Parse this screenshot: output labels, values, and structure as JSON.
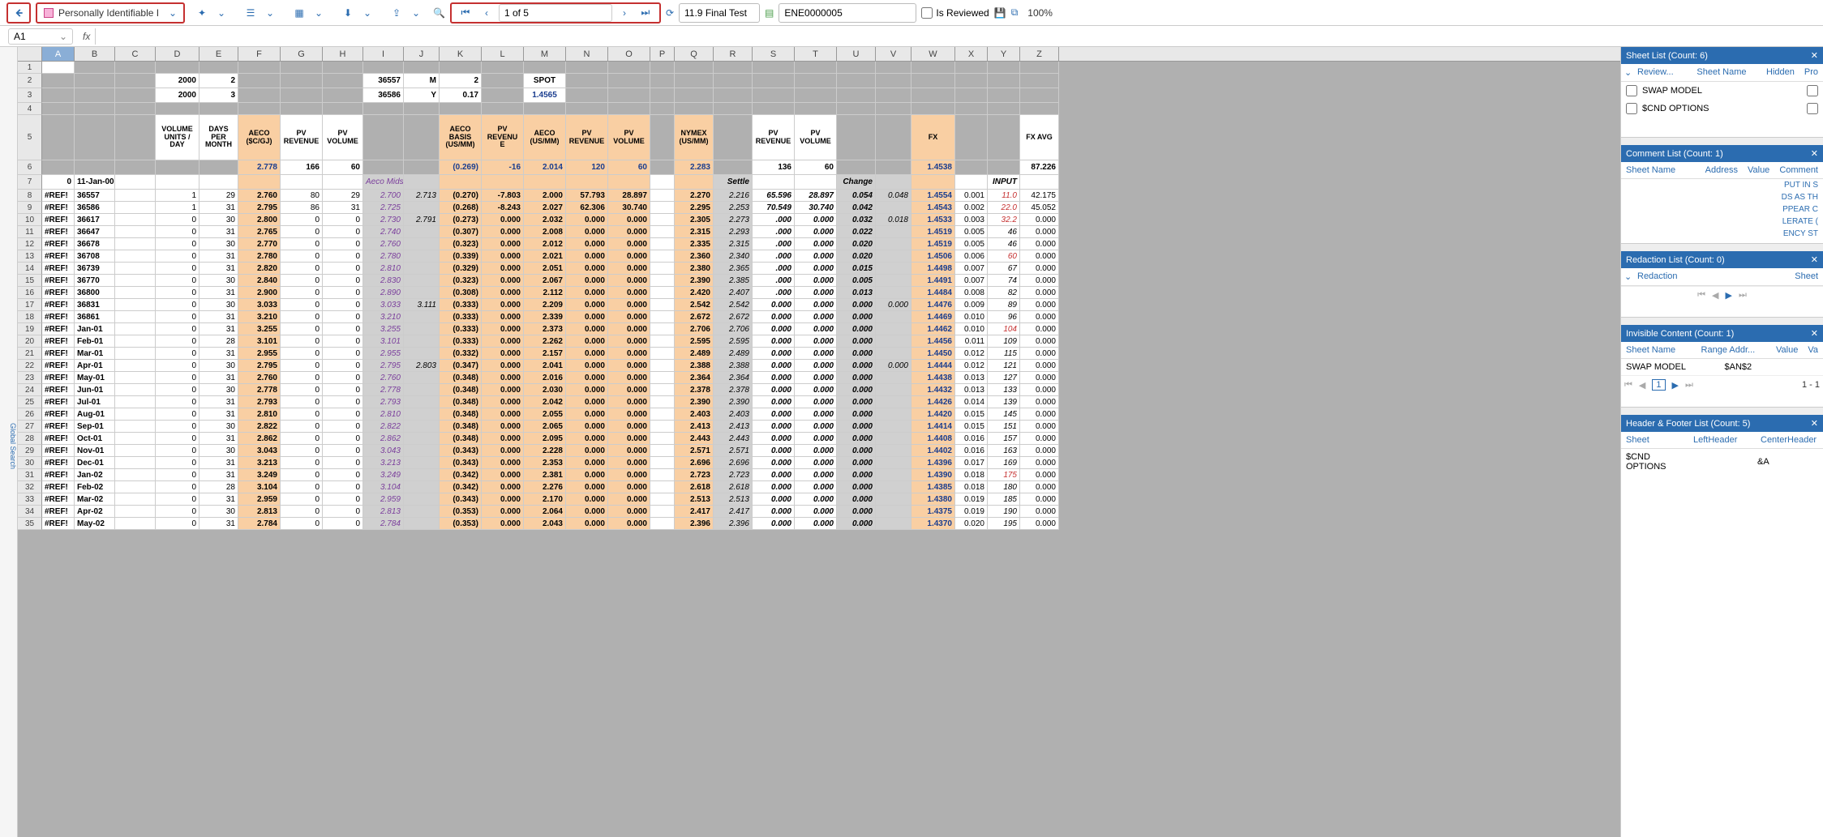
{
  "toolbar": {
    "dropdown_label": "Personally Identifiable I",
    "page_text": "1 of 5",
    "test_name": "11.9 Final Test",
    "doc_id": "ENE0000005",
    "is_reviewed_label": "Is Reviewed",
    "zoom": "100%"
  },
  "formulabar": {
    "cell": "A1",
    "fx": "fx"
  },
  "left_strip": "Global Search",
  "columns": [
    "A",
    "B",
    "C",
    "D",
    "E",
    "F",
    "G",
    "H",
    "I",
    "J",
    "K",
    "L",
    "M",
    "N",
    "O",
    "P",
    "Q",
    "R",
    "S",
    "T",
    "U",
    "V",
    "W",
    "X",
    "Y",
    "Z"
  ],
  "row2": {
    "D": "2000",
    "E": "2",
    "I": "36557",
    "J": "M",
    "K": "2",
    "M": "SPOT"
  },
  "row3": {
    "D": "2000",
    "E": "3",
    "I": "36586",
    "J": "Y",
    "K": "0.17",
    "M": "1.4565"
  },
  "headers5": {
    "D": "VOLUME UNITS / DAY",
    "E": "DAYS PER MONTH",
    "F": "AECO ($C/GJ)",
    "G": "PV REVENUE",
    "H": "PV VOLUME",
    "K": "AECO BASIS (US/MM)",
    "L": "PV REVENU E",
    "M": "AECO (US/MM)",
    "N": "PV REVENUE",
    "O": "PV VOLUME",
    "Q": "NYMEX (US/MM)",
    "S": "PV REVENUE",
    "T": "PV VOLUME",
    "W": "FX",
    "Z": "FX AVG"
  },
  "row6": {
    "F": "2.778",
    "G": "166",
    "H": "60",
    "K": "(0.269)",
    "L": "-16",
    "M": "2.014",
    "N": "120",
    "O": "60",
    "Q": "2.283",
    "S": "136",
    "T": "60",
    "W": "1.4538",
    "Z": "87.226"
  },
  "row7": {
    "A": "0",
    "B": "11-Jan-00",
    "I": "Aeco Mids",
    "R": "Settle",
    "U": "Change",
    "Y": "INPUT"
  },
  "data_rows": [
    {
      "rn": 8,
      "A": "#REF!",
      "B": "36557",
      "D": "1",
      "E": "29",
      "F": "2.760",
      "G": "80",
      "H": "29",
      "I": "2.700",
      "J": "2.713",
      "K": "(0.270)",
      "L": "-7.803",
      "M": "2.000",
      "N": "57.793",
      "O": "28.897",
      "Q": "2.270",
      "R": "2.216",
      "S": "65.596",
      "T": "28.897",
      "U": "0.054",
      "V": "0.048",
      "W": "1.4554",
      "X": "0.001",
      "Y": "11.0",
      "Z": "42.175"
    },
    {
      "rn": 9,
      "A": "#REF!",
      "B": "36586",
      "D": "1",
      "E": "31",
      "F": "2.795",
      "G": "86",
      "H": "31",
      "I": "2.725",
      "J": "",
      "K": "(0.268)",
      "L": "-8.243",
      "M": "2.027",
      "N": "62.306",
      "O": "30.740",
      "Q": "2.295",
      "R": "2.253",
      "S": "70.549",
      "T": "30.740",
      "U": "0.042",
      "V": "",
      "W": "1.4543",
      "X": "0.002",
      "Y": "22.0",
      "Z": "45.052"
    },
    {
      "rn": 10,
      "A": "#REF!",
      "B": "36617",
      "D": "0",
      "E": "30",
      "F": "2.800",
      "G": "0",
      "H": "0",
      "I": "2.730",
      "J": "2.791",
      "K": "(0.273)",
      "L": "0.000",
      "M": "2.032",
      "N": "0.000",
      "O": "0.000",
      "Q": "2.305",
      "R": "2.273",
      "S": ".000",
      "T": "0.000",
      "U": "0.032",
      "V": "0.018",
      "W": "1.4533",
      "X": "0.003",
      "Y": "32.2",
      "Z": "0.000"
    },
    {
      "rn": 11,
      "A": "#REF!",
      "B": "36647",
      "D": "0",
      "E": "31",
      "F": "2.765",
      "G": "0",
      "H": "0",
      "I": "2.740",
      "J": "",
      "K": "(0.307)",
      "L": "0.000",
      "M": "2.008",
      "N": "0.000",
      "O": "0.000",
      "Q": "2.315",
      "R": "2.293",
      "S": ".000",
      "T": "0.000",
      "U": "0.022",
      "V": "",
      "W": "1.4519",
      "X": "0.005",
      "Y": "46",
      "Z": "0.000"
    },
    {
      "rn": 12,
      "A": "#REF!",
      "B": "36678",
      "D": "0",
      "E": "30",
      "F": "2.770",
      "G": "0",
      "H": "0",
      "I": "2.760",
      "J": "",
      "K": "(0.323)",
      "L": "0.000",
      "M": "2.012",
      "N": "0.000",
      "O": "0.000",
      "Q": "2.335",
      "R": "2.315",
      "S": ".000",
      "T": "0.000",
      "U": "0.020",
      "V": "",
      "W": "1.4519",
      "X": "0.005",
      "Y": "46",
      "Z": "0.000"
    },
    {
      "rn": 13,
      "A": "#REF!",
      "B": "36708",
      "D": "0",
      "E": "31",
      "F": "2.780",
      "G": "0",
      "H": "0",
      "I": "2.780",
      "J": "",
      "K": "(0.339)",
      "L": "0.000",
      "M": "2.021",
      "N": "0.000",
      "O": "0.000",
      "Q": "2.360",
      "R": "2.340",
      "S": ".000",
      "T": "0.000",
      "U": "0.020",
      "V": "",
      "W": "1.4506",
      "X": "0.006",
      "Y": "60",
      "Z": "0.000"
    },
    {
      "rn": 14,
      "A": "#REF!",
      "B": "36739",
      "D": "0",
      "E": "31",
      "F": "2.820",
      "G": "0",
      "H": "0",
      "I": "2.810",
      "J": "",
      "K": "(0.329)",
      "L": "0.000",
      "M": "2.051",
      "N": "0.000",
      "O": "0.000",
      "Q": "2.380",
      "R": "2.365",
      "S": ".000",
      "T": "0.000",
      "U": "0.015",
      "V": "",
      "W": "1.4498",
      "X": "0.007",
      "Y": "67",
      "Z": "0.000"
    },
    {
      "rn": 15,
      "A": "#REF!",
      "B": "36770",
      "D": "0",
      "E": "30",
      "F": "2.840",
      "G": "0",
      "H": "0",
      "I": "2.830",
      "J": "",
      "K": "(0.323)",
      "L": "0.000",
      "M": "2.067",
      "N": "0.000",
      "O": "0.000",
      "Q": "2.390",
      "R": "2.385",
      "S": ".000",
      "T": "0.000",
      "U": "0.005",
      "V": "",
      "W": "1.4491",
      "X": "0.007",
      "Y": "74",
      "Z": "0.000"
    },
    {
      "rn": 16,
      "A": "#REF!",
      "B": "36800",
      "D": "0",
      "E": "31",
      "F": "2.900",
      "G": "0",
      "H": "0",
      "I": "2.890",
      "J": "",
      "K": "(0.308)",
      "L": "0.000",
      "M": "2.112",
      "N": "0.000",
      "O": "0.000",
      "Q": "2.420",
      "R": "2.407",
      "S": ".000",
      "T": "0.000",
      "U": "0.013",
      "V": "",
      "W": "1.4484",
      "X": "0.008",
      "Y": "82",
      "Z": "0.000"
    },
    {
      "rn": 17,
      "A": "#REF!",
      "B": "36831",
      "D": "0",
      "E": "30",
      "F": "3.033",
      "G": "0",
      "H": "0",
      "I": "3.033",
      "J": "3.111",
      "K": "(0.333)",
      "L": "0.000",
      "M": "2.209",
      "N": "0.000",
      "O": "0.000",
      "Q": "2.542",
      "R": "2.542",
      "S": "0.000",
      "T": "0.000",
      "U": "0.000",
      "V": "0.000",
      "W": "1.4476",
      "X": "0.009",
      "Y": "89",
      "Z": "0.000"
    },
    {
      "rn": 18,
      "A": "#REF!",
      "B": "36861",
      "D": "0",
      "E": "31",
      "F": "3.210",
      "G": "0",
      "H": "0",
      "I": "3.210",
      "J": "",
      "K": "(0.333)",
      "L": "0.000",
      "M": "2.339",
      "N": "0.000",
      "O": "0.000",
      "Q": "2.672",
      "R": "2.672",
      "S": "0.000",
      "T": "0.000",
      "U": "0.000",
      "V": "",
      "W": "1.4469",
      "X": "0.010",
      "Y": "96",
      "Z": "0.000"
    },
    {
      "rn": 19,
      "A": "#REF!",
      "B": "Jan-01",
      "D": "0",
      "E": "31",
      "F": "3.255",
      "G": "0",
      "H": "0",
      "I": "3.255",
      "J": "",
      "K": "(0.333)",
      "L": "0.000",
      "M": "2.373",
      "N": "0.000",
      "O": "0.000",
      "Q": "2.706",
      "R": "2.706",
      "S": "0.000",
      "T": "0.000",
      "U": "0.000",
      "V": "",
      "W": "1.4462",
      "X": "0.010",
      "Y": "104",
      "Z": "0.000"
    },
    {
      "rn": 20,
      "A": "#REF!",
      "B": "Feb-01",
      "D": "0",
      "E": "28",
      "F": "3.101",
      "G": "0",
      "H": "0",
      "I": "3.101",
      "J": "",
      "K": "(0.333)",
      "L": "0.000",
      "M": "2.262",
      "N": "0.000",
      "O": "0.000",
      "Q": "2.595",
      "R": "2.595",
      "S": "0.000",
      "T": "0.000",
      "U": "0.000",
      "V": "",
      "W": "1.4456",
      "X": "0.011",
      "Y": "109",
      "Z": "0.000"
    },
    {
      "rn": 21,
      "A": "#REF!",
      "B": "Mar-01",
      "D": "0",
      "E": "31",
      "F": "2.955",
      "G": "0",
      "H": "0",
      "I": "2.955",
      "J": "",
      "K": "(0.332)",
      "L": "0.000",
      "M": "2.157",
      "N": "0.000",
      "O": "0.000",
      "Q": "2.489",
      "R": "2.489",
      "S": "0.000",
      "T": "0.000",
      "U": "0.000",
      "V": "",
      "W": "1.4450",
      "X": "0.012",
      "Y": "115",
      "Z": "0.000"
    },
    {
      "rn": 22,
      "A": "#REF!",
      "B": "Apr-01",
      "D": "0",
      "E": "30",
      "F": "2.795",
      "G": "0",
      "H": "0",
      "I": "2.795",
      "J": "2.803",
      "K": "(0.347)",
      "L": "0.000",
      "M": "2.041",
      "N": "0.000",
      "O": "0.000",
      "Q": "2.388",
      "R": "2.388",
      "S": "0.000",
      "T": "0.000",
      "U": "0.000",
      "V": "0.000",
      "W": "1.4444",
      "X": "0.012",
      "Y": "121",
      "Z": "0.000"
    },
    {
      "rn": 23,
      "A": "#REF!",
      "B": "May-01",
      "D": "0",
      "E": "31",
      "F": "2.760",
      "G": "0",
      "H": "0",
      "I": "2.760",
      "J": "",
      "K": "(0.348)",
      "L": "0.000",
      "M": "2.016",
      "N": "0.000",
      "O": "0.000",
      "Q": "2.364",
      "R": "2.364",
      "S": "0.000",
      "T": "0.000",
      "U": "0.000",
      "V": "",
      "W": "1.4438",
      "X": "0.013",
      "Y": "127",
      "Z": "0.000"
    },
    {
      "rn": 24,
      "A": "#REF!",
      "B": "Jun-01",
      "D": "0",
      "E": "30",
      "F": "2.778",
      "G": "0",
      "H": "0",
      "I": "2.778",
      "J": "",
      "K": "(0.348)",
      "L": "0.000",
      "M": "2.030",
      "N": "0.000",
      "O": "0.000",
      "Q": "2.378",
      "R": "2.378",
      "S": "0.000",
      "T": "0.000",
      "U": "0.000",
      "V": "",
      "W": "1.4432",
      "X": "0.013",
      "Y": "133",
      "Z": "0.000"
    },
    {
      "rn": 25,
      "A": "#REF!",
      "B": "Jul-01",
      "D": "0",
      "E": "31",
      "F": "2.793",
      "G": "0",
      "H": "0",
      "I": "2.793",
      "J": "",
      "K": "(0.348)",
      "L": "0.000",
      "M": "2.042",
      "N": "0.000",
      "O": "0.000",
      "Q": "2.390",
      "R": "2.390",
      "S": "0.000",
      "T": "0.000",
      "U": "0.000",
      "V": "",
      "W": "1.4426",
      "X": "0.014",
      "Y": "139",
      "Z": "0.000"
    },
    {
      "rn": 26,
      "A": "#REF!",
      "B": "Aug-01",
      "D": "0",
      "E": "31",
      "F": "2.810",
      "G": "0",
      "H": "0",
      "I": "2.810",
      "J": "",
      "K": "(0.348)",
      "L": "0.000",
      "M": "2.055",
      "N": "0.000",
      "O": "0.000",
      "Q": "2.403",
      "R": "2.403",
      "S": "0.000",
      "T": "0.000",
      "U": "0.000",
      "V": "",
      "W": "1.4420",
      "X": "0.015",
      "Y": "145",
      "Z": "0.000"
    },
    {
      "rn": 27,
      "A": "#REF!",
      "B": "Sep-01",
      "D": "0",
      "E": "30",
      "F": "2.822",
      "G": "0",
      "H": "0",
      "I": "2.822",
      "J": "",
      "K": "(0.348)",
      "L": "0.000",
      "M": "2.065",
      "N": "0.000",
      "O": "0.000",
      "Q": "2.413",
      "R": "2.413",
      "S": "0.000",
      "T": "0.000",
      "U": "0.000",
      "V": "",
      "W": "1.4414",
      "X": "0.015",
      "Y": "151",
      "Z": "0.000"
    },
    {
      "rn": 28,
      "A": "#REF!",
      "B": "Oct-01",
      "D": "0",
      "E": "31",
      "F": "2.862",
      "G": "0",
      "H": "0",
      "I": "2.862",
      "J": "",
      "K": "(0.348)",
      "L": "0.000",
      "M": "2.095",
      "N": "0.000",
      "O": "0.000",
      "Q": "2.443",
      "R": "2.443",
      "S": "0.000",
      "T": "0.000",
      "U": "0.000",
      "V": "",
      "W": "1.4408",
      "X": "0.016",
      "Y": "157",
      "Z": "0.000"
    },
    {
      "rn": 29,
      "A": "#REF!",
      "B": "Nov-01",
      "D": "0",
      "E": "30",
      "F": "3.043",
      "G": "0",
      "H": "0",
      "I": "3.043",
      "J": "",
      "K": "(0.343)",
      "L": "0.000",
      "M": "2.228",
      "N": "0.000",
      "O": "0.000",
      "Q": "2.571",
      "R": "2.571",
      "S": "0.000",
      "T": "0.000",
      "U": "0.000",
      "V": "",
      "W": "1.4402",
      "X": "0.016",
      "Y": "163",
      "Z": "0.000"
    },
    {
      "rn": 30,
      "A": "#REF!",
      "B": "Dec-01",
      "D": "0",
      "E": "31",
      "F": "3.213",
      "G": "0",
      "H": "0",
      "I": "3.213",
      "J": "",
      "K": "(0.343)",
      "L": "0.000",
      "M": "2.353",
      "N": "0.000",
      "O": "0.000",
      "Q": "2.696",
      "R": "2.696",
      "S": "0.000",
      "T": "0.000",
      "U": "0.000",
      "V": "",
      "W": "1.4396",
      "X": "0.017",
      "Y": "169",
      "Z": "0.000"
    },
    {
      "rn": 31,
      "A": "#REF!",
      "B": "Jan-02",
      "D": "0",
      "E": "31",
      "F": "3.249",
      "G": "0",
      "H": "0",
      "I": "3.249",
      "J": "",
      "K": "(0.342)",
      "L": "0.000",
      "M": "2.381",
      "N": "0.000",
      "O": "0.000",
      "Q": "2.723",
      "R": "2.723",
      "S": "0.000",
      "T": "0.000",
      "U": "0.000",
      "V": "",
      "W": "1.4390",
      "X": "0.018",
      "Y": "175",
      "Z": "0.000"
    },
    {
      "rn": 32,
      "A": "#REF!",
      "B": "Feb-02",
      "D": "0",
      "E": "28",
      "F": "3.104",
      "G": "0",
      "H": "0",
      "I": "3.104",
      "J": "",
      "K": "(0.342)",
      "L": "0.000",
      "M": "2.276",
      "N": "0.000",
      "O": "0.000",
      "Q": "2.618",
      "R": "2.618",
      "S": "0.000",
      "T": "0.000",
      "U": "0.000",
      "V": "",
      "W": "1.4385",
      "X": "0.018",
      "Y": "180",
      "Z": "0.000"
    },
    {
      "rn": 33,
      "A": "#REF!",
      "B": "Mar-02",
      "D": "0",
      "E": "31",
      "F": "2.959",
      "G": "0",
      "H": "0",
      "I": "2.959",
      "J": "",
      "K": "(0.343)",
      "L": "0.000",
      "M": "2.170",
      "N": "0.000",
      "O": "0.000",
      "Q": "2.513",
      "R": "2.513",
      "S": "0.000",
      "T": "0.000",
      "U": "0.000",
      "V": "",
      "W": "1.4380",
      "X": "0.019",
      "Y": "185",
      "Z": "0.000"
    },
    {
      "rn": 34,
      "A": "#REF!",
      "B": "Apr-02",
      "D": "0",
      "E": "30",
      "F": "2.813",
      "G": "0",
      "H": "0",
      "I": "2.813",
      "J": "",
      "K": "(0.353)",
      "L": "0.000",
      "M": "2.064",
      "N": "0.000",
      "O": "0.000",
      "Q": "2.417",
      "R": "2.417",
      "S": "0.000",
      "T": "0.000",
      "U": "0.000",
      "V": "",
      "W": "1.4375",
      "X": "0.019",
      "Y": "190",
      "Z": "0.000"
    },
    {
      "rn": 35,
      "A": "#REF!",
      "B": "May-02",
      "D": "0",
      "E": "31",
      "F": "2.784",
      "G": "0",
      "H": "0",
      "I": "2.784",
      "J": "",
      "K": "(0.353)",
      "L": "0.000",
      "M": "2.043",
      "N": "0.000",
      "O": "0.000",
      "Q": "2.396",
      "R": "2.396",
      "S": "0.000",
      "T": "0.000",
      "U": "0.000",
      "V": "",
      "W": "1.4370",
      "X": "0.020",
      "Y": "195",
      "Z": "0.000"
    }
  ],
  "peach_cols": [
    "F",
    "K",
    "L",
    "M",
    "N",
    "O",
    "Q",
    "W"
  ],
  "grey_cols": [
    "I",
    "J",
    "R",
    "U",
    "V"
  ],
  "red_Y_rows": [
    8,
    9,
    10,
    13,
    19,
    31
  ],
  "panels": {
    "sheet_list": {
      "title": "Sheet List (Count: 6)",
      "cols": [
        "Review...",
        "Sheet Name",
        "Hidden",
        "Pro"
      ],
      "rows": [
        {
          "name": "SWAP MODEL"
        },
        {
          "name": "$CND OPTIONS"
        }
      ]
    },
    "comment_list": {
      "title": "Comment List (Count: 1)",
      "cols": [
        "Sheet Name",
        "Address",
        "Value",
        "Comment"
      ],
      "snippet": [
        "PUT IN S",
        "DS AS TH",
        "PPEAR C",
        "LERATE (",
        "ENCY ST"
      ]
    },
    "redaction_list": {
      "title": "Redaction List (Count: 0)",
      "cols": [
        "Redaction",
        "Sheet"
      ]
    },
    "invisible": {
      "title": "Invisible Content (Count: 1)",
      "cols": [
        "Sheet Name",
        "Range Addr...",
        "Value",
        "Va"
      ],
      "row": {
        "sheet": "SWAP MODEL",
        "range": "$AN$2"
      },
      "pager_page": "1",
      "pager_total": "1 - 1"
    },
    "header_footer": {
      "title": "Header & Footer List (Count: 5)",
      "cols": [
        "Sheet",
        "LeftHeader",
        "CenterHeader"
      ],
      "row": {
        "sheet": "$CND OPTIONS",
        "center": "&A"
      }
    }
  }
}
